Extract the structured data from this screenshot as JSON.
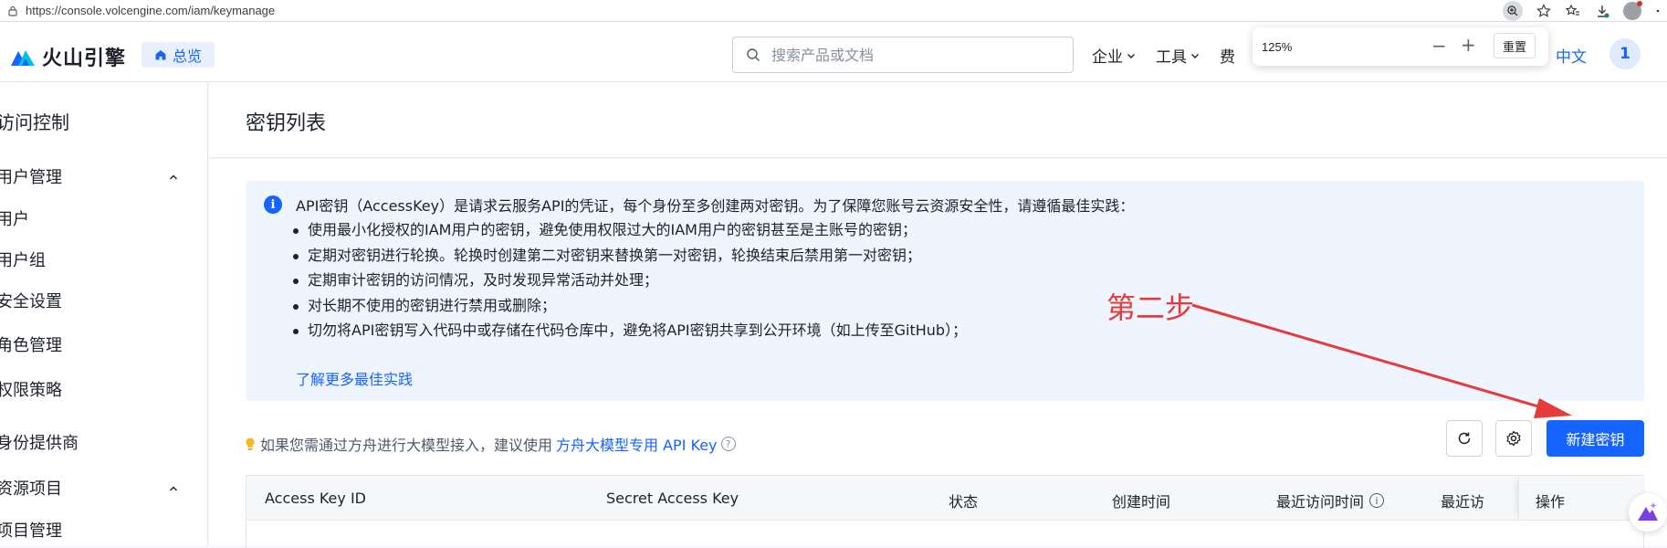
{
  "browser": {
    "url": "https://console.volcengine.com/iam/keymanage",
    "zoom_popup": {
      "level": "125%",
      "minus": "−",
      "plus": "+",
      "reset": "重置"
    }
  },
  "topnav": {
    "logo_text": "火山引擎",
    "overview": "总览",
    "search_placeholder": "搜索产品或文档",
    "menu": [
      "企业",
      "工具",
      "费"
    ],
    "language": "中文",
    "user_initial": "1"
  },
  "sidebar": {
    "title": "访问控制",
    "group_user_mgmt": "用户管理",
    "items": [
      "用户",
      "用户组",
      "安全设置",
      "角色管理",
      "权限策略",
      "身份提供商"
    ],
    "group_resource": "资源项目",
    "resource_items": [
      "项目管理"
    ]
  },
  "page": {
    "title": "密钥列表",
    "info": {
      "main": "API密钥（AccessKey）是请求云服务API的凭证，每个身份至多创建两对密钥。为了保障您账号云资源安全性，请遵循最佳实践：",
      "bullets": [
        "使用最小化授权的IAM用户的密钥，避免使用权限过大的IAM用户的密钥甚至是主账号的密钥；",
        "定期对密钥进行轮换。轮换时创建第二对密钥来替换第一对密钥，轮换结束后禁用第一对密钥；",
        "定期审计密钥的访问情况，及时发现异常活动并处理；",
        "对长期不使用的密钥进行禁用或删除；",
        "切勿将API密钥写入代码中或存储在代码仓库中，避免将API密钥共享到公开环境（如上传至GitHub）；"
      ],
      "link": "了解更多最佳实践"
    },
    "tip": {
      "text": "如果您需通过方舟进行大模型接入，建议使用",
      "link": "方舟大模型专用 API Key"
    },
    "create_button": "新建密钥",
    "table_columns": [
      "Access Key ID",
      "Secret Access Key",
      "状态",
      "创建时间",
      "最近访问时间",
      "最近访",
      "操作"
    ]
  },
  "annotation": {
    "text": "第二步",
    "color": "#e63b3b"
  },
  "colors": {
    "primary": "#1664ff",
    "info_bg": "#eff5ff"
  }
}
